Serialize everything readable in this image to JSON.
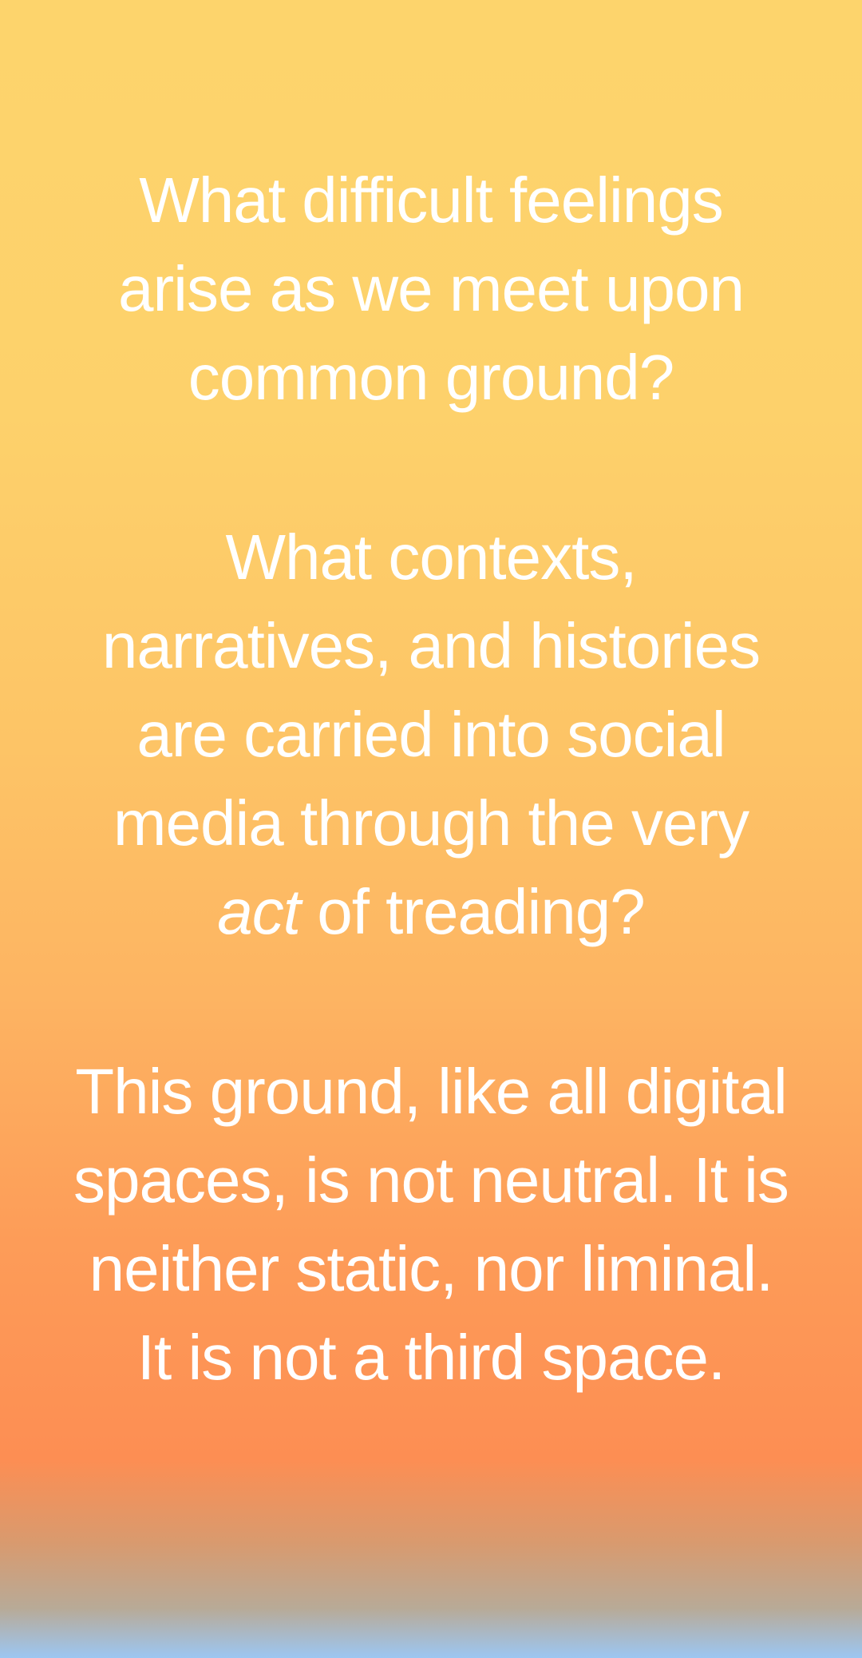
{
  "story": {
    "paragraph_1": [
      "What difficult feelings",
      "arise as we meet upon",
      "common ground?"
    ],
    "paragraph_2": {
      "lines": [
        "What contexts,",
        "narratives, and histories",
        "are carried into social",
        "media through the very"
      ],
      "last_line_italic": "act",
      "last_line_rest": " of treading?"
    },
    "paragraph_3": [
      "This ground, like all digital",
      "spaces, is not neutral. It is",
      "neither static, nor liminal.",
      "It is not a third space."
    ],
    "colors": {
      "text": "#ffffff",
      "gradient_top": "#fdd46c",
      "gradient_mid": "#fd8e53",
      "gradient_bottom": "#9cc6f2"
    }
  }
}
